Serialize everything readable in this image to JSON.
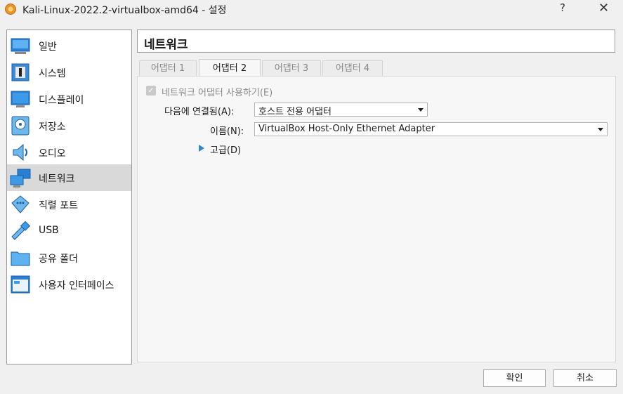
{
  "window": {
    "title": "Kali-Linux-2022.2-virtualbox-amd64 - 설정",
    "help": "?",
    "close": "✕"
  },
  "sidebar": {
    "items": [
      {
        "label": "일반",
        "icon": "monitor-icon"
      },
      {
        "label": "시스템",
        "icon": "chip-icon"
      },
      {
        "label": "디스플레이",
        "icon": "display-icon"
      },
      {
        "label": "저장소",
        "icon": "disk-icon"
      },
      {
        "label": "오디오",
        "icon": "speaker-icon"
      },
      {
        "label": "네트워크",
        "icon": "network-icon",
        "selected": true
      },
      {
        "label": "직렬 포트",
        "icon": "serial-port-icon"
      },
      {
        "label": "USB",
        "icon": "usb-icon"
      },
      {
        "label": "공유 폴더",
        "icon": "folder-icon"
      },
      {
        "label": "사용자 인터페이스",
        "icon": "window-icon"
      }
    ]
  },
  "page": {
    "title": "네트워크"
  },
  "tabs": [
    {
      "label": "어댑터 1"
    },
    {
      "label": "어댑터 2",
      "active": true
    },
    {
      "label": "어댑터 3"
    },
    {
      "label": "어댑터 4"
    }
  ],
  "adapter": {
    "enable_label": "네트워크 어댑터 사용하기(E)",
    "enable_checked": true,
    "attached_label": "다음에 연결됨(A):",
    "attached_value": "호스트 전용 어댑터",
    "name_label": "이름(N):",
    "name_value": "VirtualBox Host-Only Ethernet Adapter",
    "advanced_label": "고급(D)"
  },
  "buttons": {
    "ok": "확인",
    "cancel": "취소"
  },
  "colors": {
    "accent": "#2f86d3",
    "selected_bg": "#d9d9d9"
  }
}
